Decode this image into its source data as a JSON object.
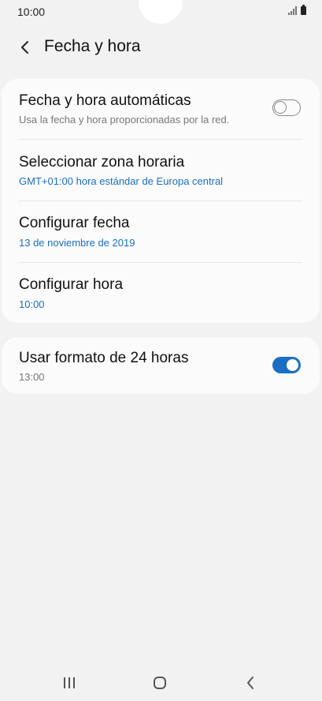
{
  "status": {
    "time": "10:00"
  },
  "header": {
    "title": "Fecha y hora",
    "back_icon": "chevron-left-icon"
  },
  "settings": {
    "auto_datetime": {
      "title": "Fecha y hora automáticas",
      "subtitle": "Usa la fecha y hora proporcionadas por la red.",
      "enabled": false
    },
    "timezone": {
      "title": "Seleccionar zona horaria",
      "value": "GMT+01:00 hora estándar de Europa central"
    },
    "set_date": {
      "title": "Configurar fecha",
      "value": "13 de noviembre de 2019"
    },
    "set_time": {
      "title": "Configurar hora",
      "value": "10:00"
    },
    "format_24h": {
      "title": "Usar formato de 24 horas",
      "subtitle": "13:00",
      "enabled": true
    }
  },
  "colors": {
    "accent": "#1a6fc2",
    "background": "#f2f2f2",
    "card": "#fbfbfb"
  },
  "navbar": {
    "icons": [
      "recent-apps-icon",
      "home-icon",
      "back-icon"
    ]
  }
}
